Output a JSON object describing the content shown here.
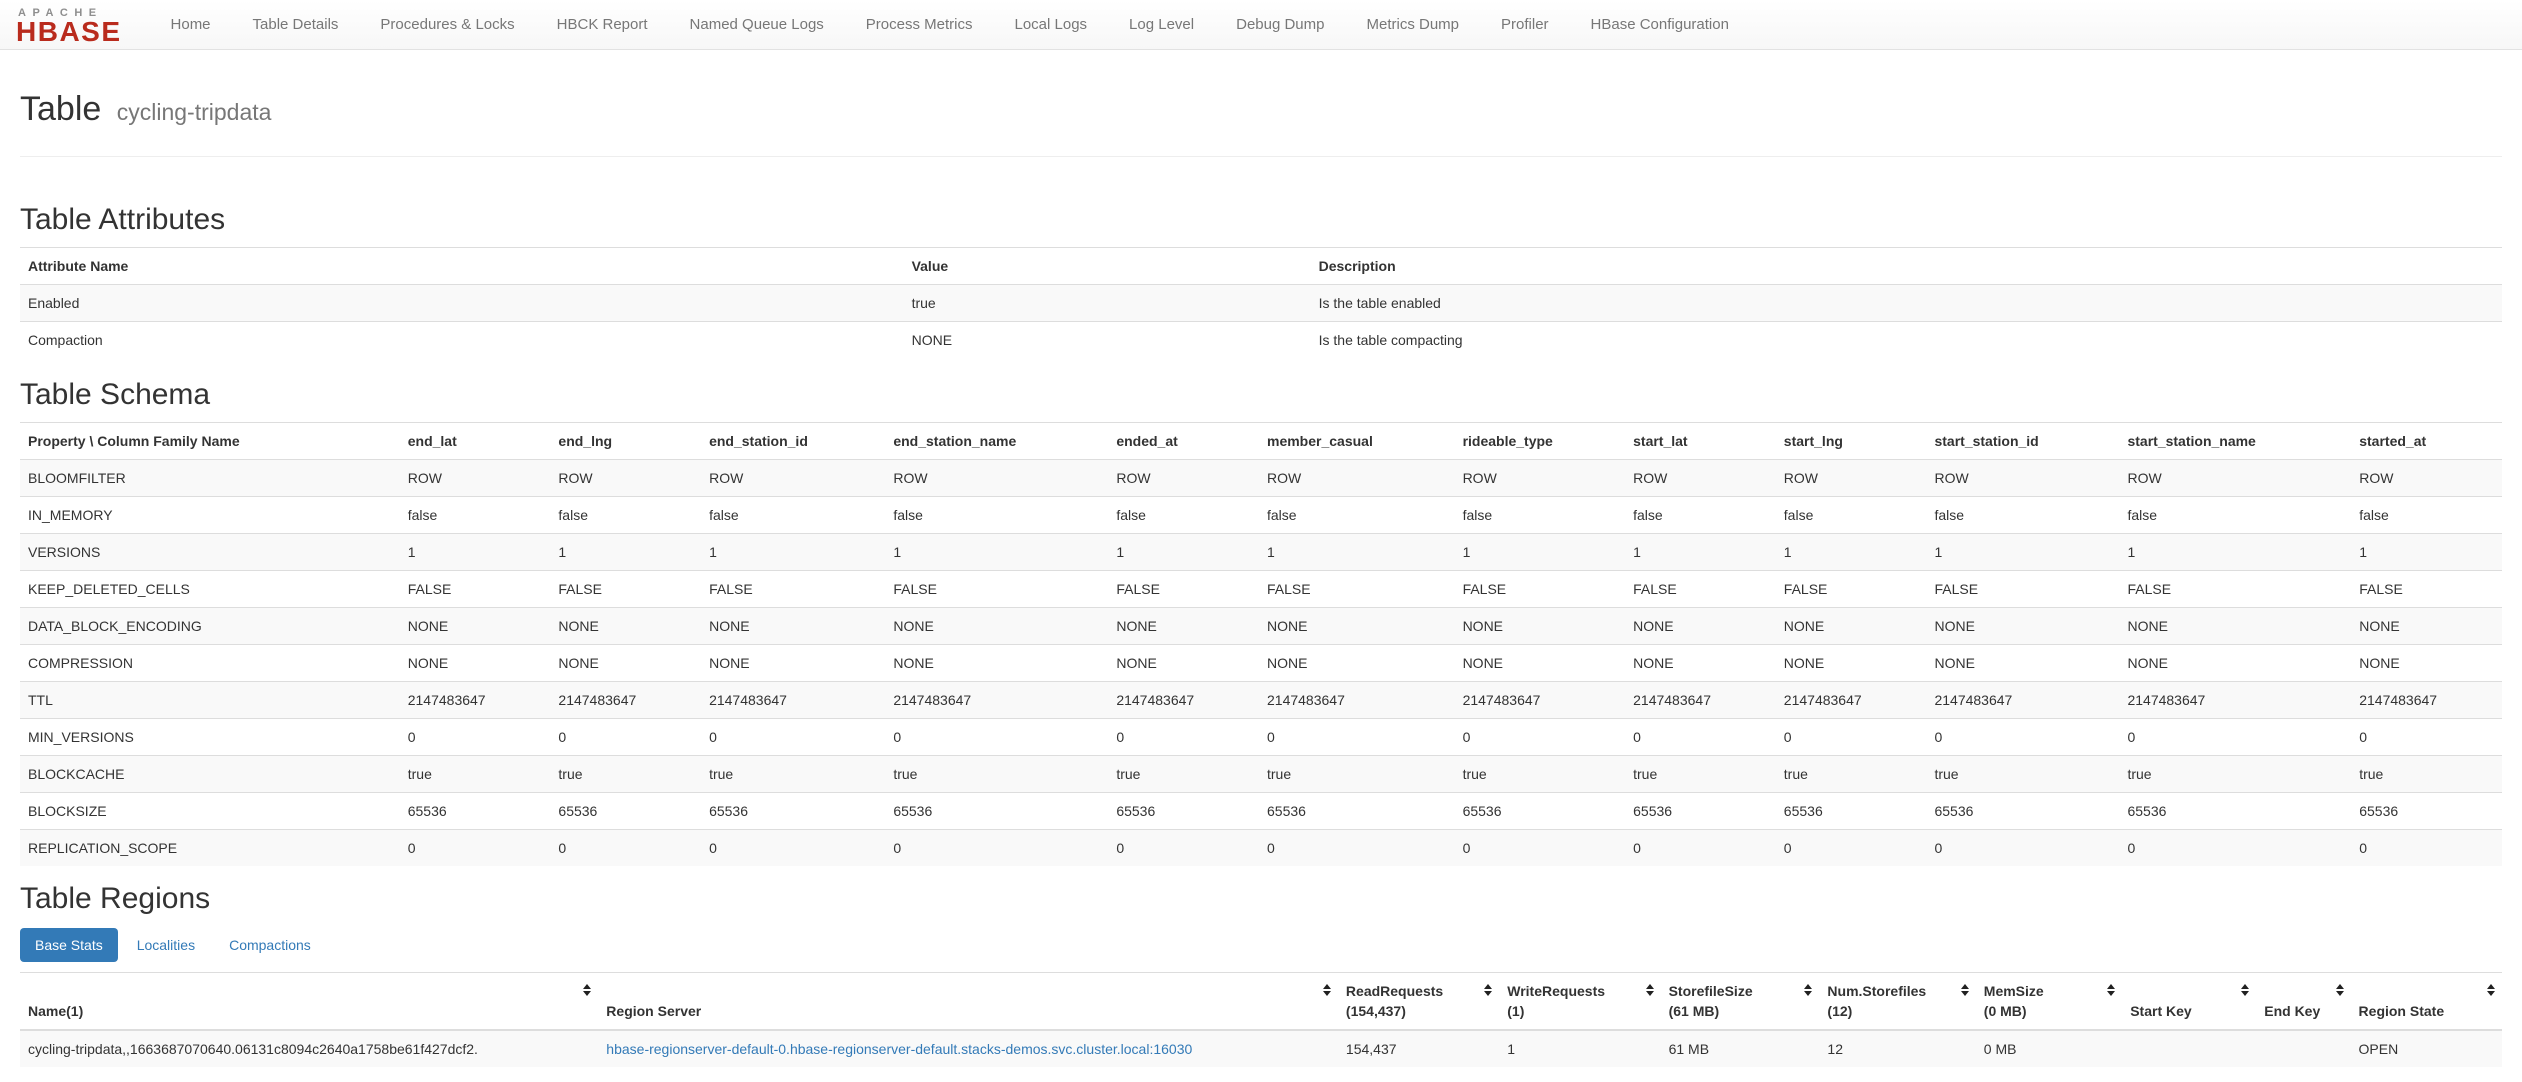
{
  "colors": {
    "accent_blue": "#337ab7",
    "brand_red": "#b92b1d",
    "brand_gray": "#8e8e8e",
    "navbar_bg": "#f7f7f7",
    "stripe_bg": "#f9f9f9",
    "table_border": "#dddddd",
    "nav_text": "#777777",
    "body_text": "#333333"
  },
  "nav": {
    "brand": {
      "top": "APACHE",
      "bottom": "HBASE"
    },
    "items": [
      {
        "label": "Home"
      },
      {
        "label": "Table Details"
      },
      {
        "label": "Procedures & Locks"
      },
      {
        "label": "HBCK Report"
      },
      {
        "label": "Named Queue Logs"
      },
      {
        "label": "Process Metrics"
      },
      {
        "label": "Local Logs"
      },
      {
        "label": "Log Level"
      },
      {
        "label": "Debug Dump"
      },
      {
        "label": "Metrics Dump"
      },
      {
        "label": "Profiler"
      },
      {
        "label": "HBase Configuration"
      }
    ]
  },
  "page": {
    "title": "Table",
    "subtitle": "cycling-tripdata"
  },
  "attributes": {
    "heading": "Table Attributes",
    "columns": [
      "Attribute Name",
      "Value",
      "Description"
    ],
    "rows": [
      {
        "name": "Enabled",
        "value": "true",
        "description": "Is the table enabled"
      },
      {
        "name": "Compaction",
        "value": "NONE",
        "description": "Is the table compacting"
      }
    ]
  },
  "schema": {
    "heading": "Table Schema",
    "corner_header": "Property \\ Column Family Name",
    "column_families": [
      "end_lat",
      "end_lng",
      "end_station_id",
      "end_station_name",
      "ended_at",
      "member_casual",
      "rideable_type",
      "start_lat",
      "start_lng",
      "start_station_id",
      "start_station_name",
      "started_at"
    ],
    "properties": [
      {
        "name": "BLOOMFILTER",
        "value": "ROW"
      },
      {
        "name": "IN_MEMORY",
        "value": "false"
      },
      {
        "name": "VERSIONS",
        "value": "1"
      },
      {
        "name": "KEEP_DELETED_CELLS",
        "value": "FALSE"
      },
      {
        "name": "DATA_BLOCK_ENCODING",
        "value": "NONE"
      },
      {
        "name": "COMPRESSION",
        "value": "NONE"
      },
      {
        "name": "TTL",
        "value": "2147483647"
      },
      {
        "name": "MIN_VERSIONS",
        "value": "0"
      },
      {
        "name": "BLOCKCACHE",
        "value": "true"
      },
      {
        "name": "BLOCKSIZE",
        "value": "65536"
      },
      {
        "name": "REPLICATION_SCOPE",
        "value": "0"
      }
    ]
  },
  "regions": {
    "heading": "Table Regions",
    "tabs": [
      {
        "label": "Base Stats",
        "active": true
      },
      {
        "label": "Localities",
        "active": false
      },
      {
        "label": "Compactions",
        "active": false
      }
    ],
    "columns": [
      {
        "key": "name",
        "label": "Name(1)",
        "sub": ""
      },
      {
        "key": "region_server",
        "label": "Region Server",
        "sub": ""
      },
      {
        "key": "read_requests",
        "label": "ReadRequests",
        "sub": "(154,437)"
      },
      {
        "key": "write_requests",
        "label": "WriteRequests",
        "sub": "(1)"
      },
      {
        "key": "storefile_size",
        "label": "StorefileSize",
        "sub": "(61 MB)"
      },
      {
        "key": "num_storefiles",
        "label": "Num.Storefiles",
        "sub": "(12)"
      },
      {
        "key": "mem_size",
        "label": "MemSize",
        "sub": "(0 MB)"
      },
      {
        "key": "start_key",
        "label": "Start Key",
        "sub": ""
      },
      {
        "key": "end_key",
        "label": "End Key",
        "sub": ""
      },
      {
        "key": "region_state",
        "label": "Region State",
        "sub": ""
      }
    ],
    "rows": [
      {
        "name": "cycling-tripdata,,1663687070640.06131c8094c2640a1758be61f427dcf2.",
        "region_server": "hbase-regionserver-default-0.hbase-regionserver-default.stacks-demos.svc.cluster.local:16030",
        "read_requests": "154,437",
        "write_requests": "1",
        "storefile_size": "61 MB",
        "num_storefiles": "12",
        "mem_size": "0 MB",
        "start_key": "",
        "end_key": "",
        "region_state": "OPEN"
      }
    ]
  }
}
